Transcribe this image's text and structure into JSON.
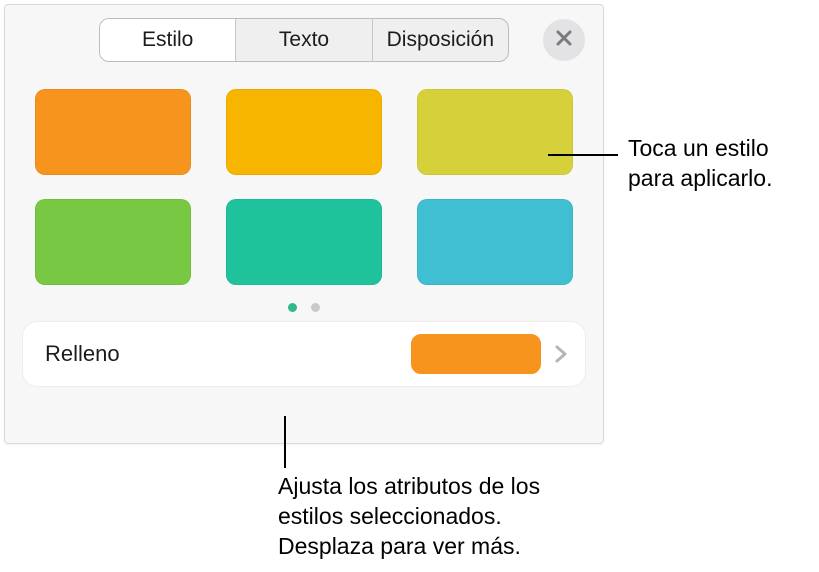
{
  "tabs": {
    "style": "Estilo",
    "text": "Texto",
    "layout": "Disposición",
    "active": "style"
  },
  "swatches": {
    "row1": [
      "#f7941d",
      "#f7b500",
      "#d6d13a"
    ],
    "row2": [
      "#79c843",
      "#1fc39b",
      "#3fbfd1"
    ]
  },
  "pagination": {
    "count": 2,
    "active": 0
  },
  "fill": {
    "label": "Relleno",
    "color": "#f7941d"
  },
  "callouts": {
    "top": "Toca un estilo para aplicarlo.",
    "bottom": "Ajusta los atributos de los estilos seleccionados. Desplaza para ver más."
  }
}
